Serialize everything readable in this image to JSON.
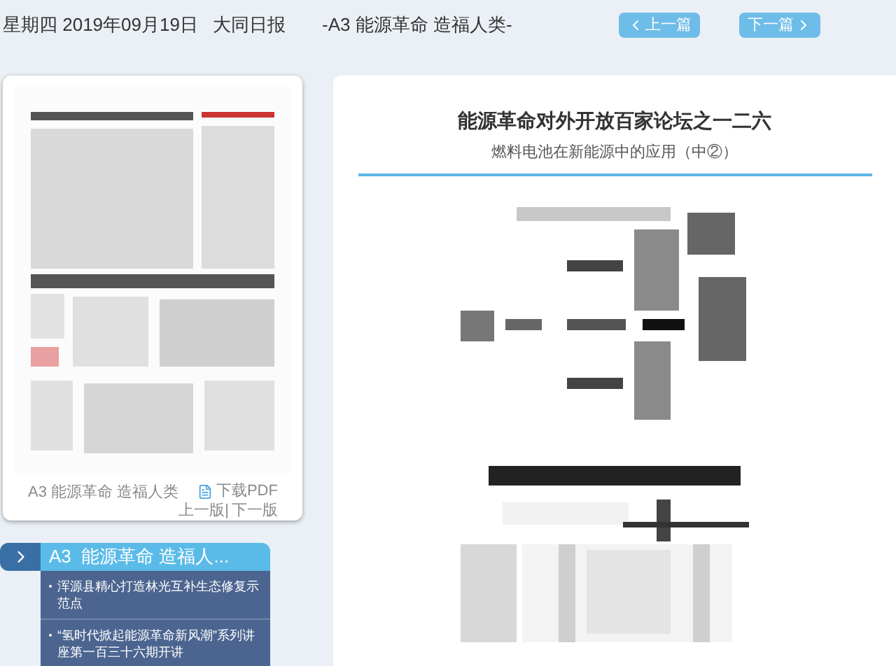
{
  "header": {
    "date": "星期四 2019年09月19日",
    "paper": "大同日报",
    "page_title": "-A3 能源革命 造福人类-",
    "prev_button": "上一篇",
    "next_button": "下一篇"
  },
  "page_panel": {
    "page_label": "A3 能源革命 造福人类",
    "download": "下载PDF",
    "prev_page": "上一版|",
    "next_page": "下一版"
  },
  "article_nav": {
    "title": "A3  能源革命 造福人...",
    "items": [
      {
        "title": "浑源县精心打造林光互补生态修复示范点"
      },
      {
        "title": "“氢时代掀起能源革命新风潮”系列讲座第一百三十六期开讲"
      }
    ]
  },
  "article": {
    "title": "能源革命对外开放百家论坛之一二六",
    "subtitle": "燃料电池在新能源中的应用（中②）",
    "figures": [
      {
        "kind": "chain"
      },
      {
        "kind": "table"
      }
    ]
  }
}
